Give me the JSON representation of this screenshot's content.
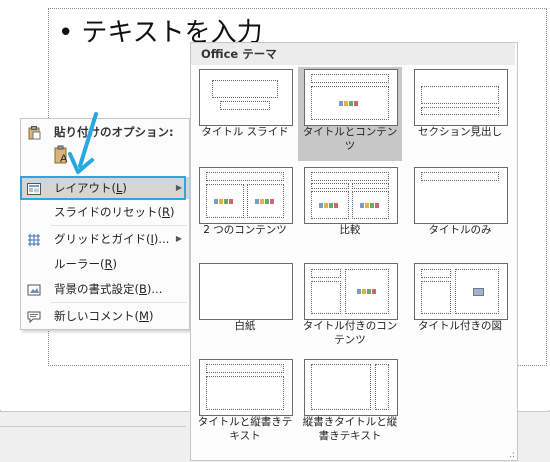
{
  "slide": {
    "bullet": "•",
    "text": "テキストを入力"
  },
  "context_menu": {
    "paste_options_label": "貼り付けのオプション:",
    "items": [
      {
        "label": "レイアウト(",
        "key": "L",
        "tail": ")",
        "has_submenu": true,
        "icon": "layout-icon"
      },
      {
        "label": "スライドのリセット(",
        "key": "R",
        "tail": ")",
        "has_submenu": false,
        "icon": ""
      },
      {
        "label": "グリッドとガイド(",
        "key": "I",
        "tail": ")...",
        "has_submenu": true,
        "icon": "grid-icon"
      },
      {
        "label": "ルーラー(",
        "key": "R",
        "tail": ")",
        "has_submenu": false,
        "icon": ""
      },
      {
        "label": "背景の書式設定(",
        "key": "B",
        "tail": ")...",
        "has_submenu": false,
        "icon": "background-format-icon"
      },
      {
        "label": "新しいコメント(",
        "key": "M",
        "tail": ")",
        "has_submenu": false,
        "icon": "new-comment-icon"
      }
    ]
  },
  "gallery": {
    "header": "Office テーマ",
    "layouts": [
      {
        "label": "タイトル スライド",
        "selected": false
      },
      {
        "label": "タイトルとコンテンツ",
        "selected": true
      },
      {
        "label": "セクション見出し",
        "selected": false
      },
      {
        "label": "2 つのコンテンツ",
        "selected": false
      },
      {
        "label": "比較",
        "selected": false
      },
      {
        "label": "タイトルのみ",
        "selected": false
      },
      {
        "label": "白紙",
        "selected": false
      },
      {
        "label": "タイトル付きのコンテンツ",
        "selected": false
      },
      {
        "label": "タイトル付きの図",
        "selected": false
      },
      {
        "label": "タイトルと縦書きテキスト",
        "selected": false
      },
      {
        "label": "縦書きタイトルと縦書きテキスト",
        "selected": false
      }
    ],
    "resize_grip": ".:"
  },
  "colors": {
    "highlight_border": "#29a8e0",
    "annotation_arrow": "#29a8e0",
    "selected_tile": "#c7c7c7"
  }
}
